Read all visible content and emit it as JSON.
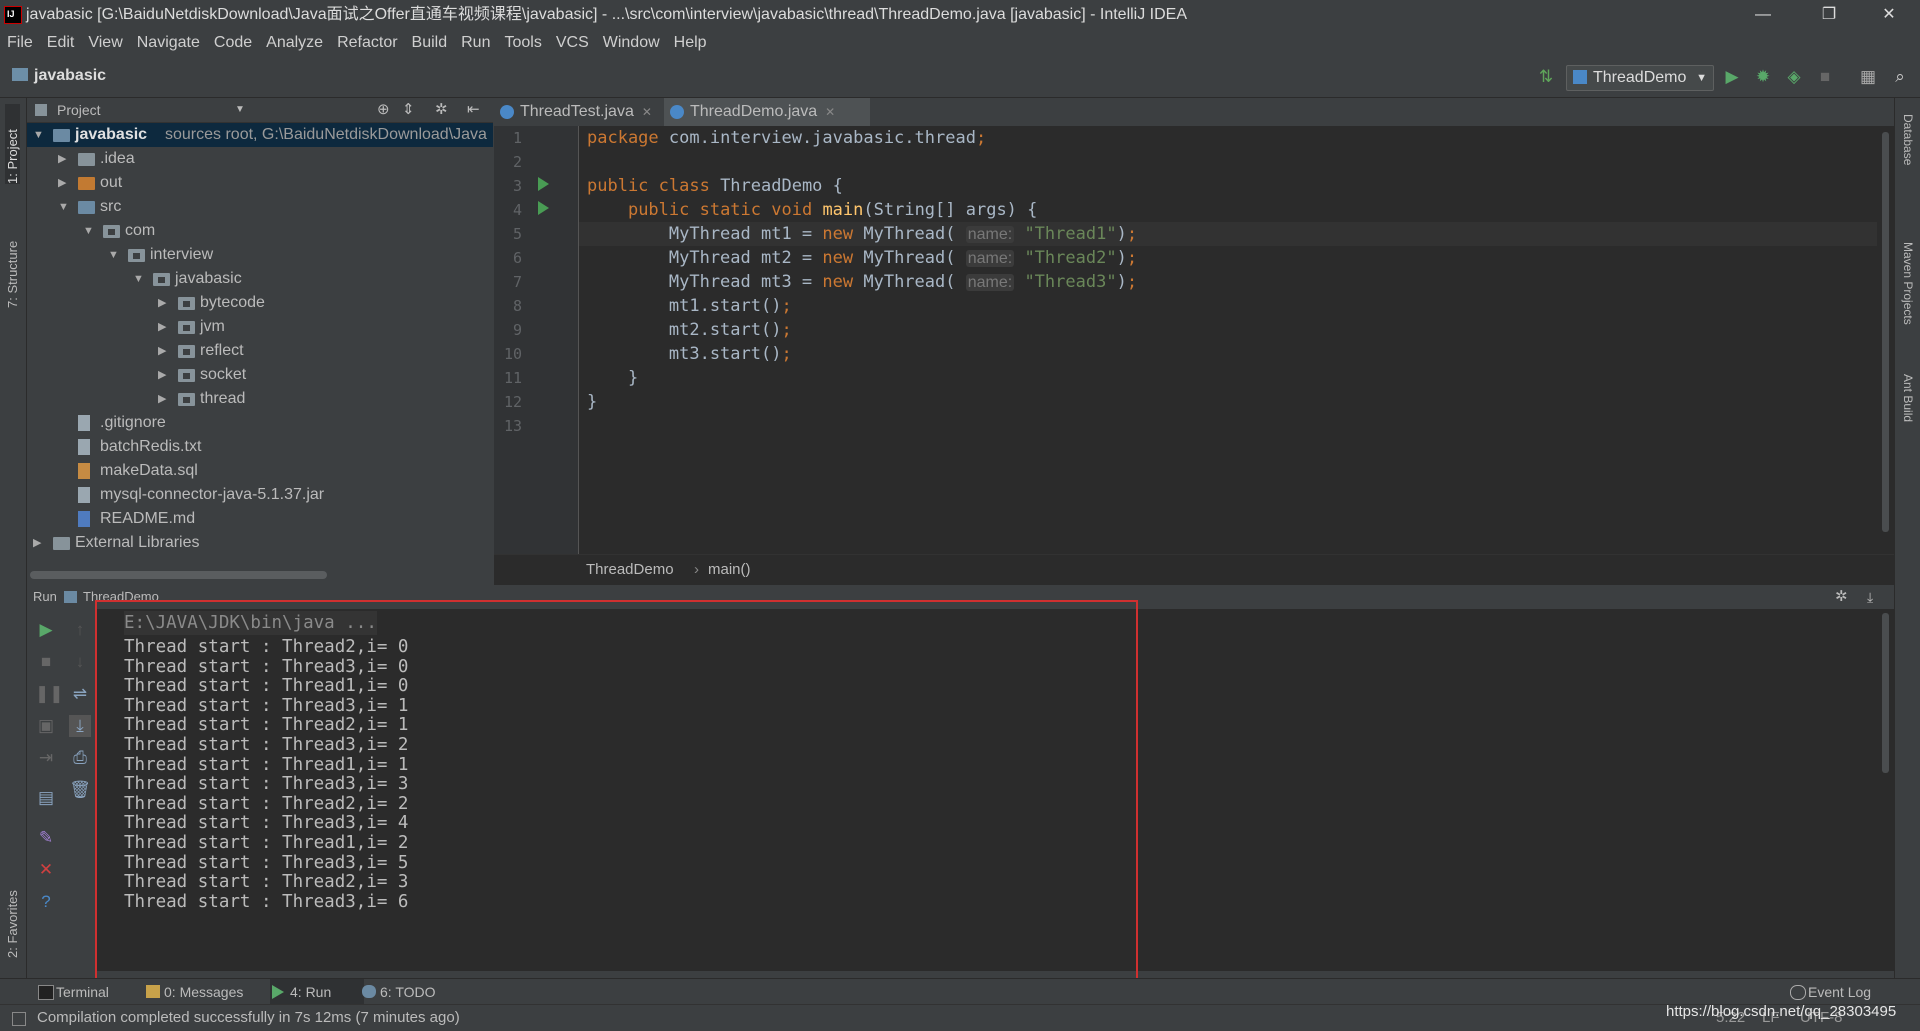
{
  "window": {
    "title": "javabasic [G:\\BaiduNetdiskDownload\\Java面试之Offer直通车视频课程\\javabasic] - ...\\src\\com\\interview\\javabasic\\thread\\ThreadDemo.java [javabasic] - IntelliJ IDEA",
    "minimize": "—",
    "restore": "❐",
    "close": "✕"
  },
  "menu": [
    "File",
    "Edit",
    "View",
    "Navigate",
    "Code",
    "Analyze",
    "Refactor",
    "Build",
    "Run",
    "Tools",
    "VCS",
    "Window",
    "Help"
  ],
  "nav": {
    "project": "javabasic",
    "run_config": "ThreadDemo",
    "icons": [
      "build-icon",
      "run-icon",
      "debug-icon",
      "coverage-icon",
      "stop-icon",
      "project-structure-icon",
      "search-icon"
    ]
  },
  "left_strip": {
    "project": "1: Project",
    "structure": "7: Structure",
    "favorites": "2: Favorites"
  },
  "right_strip": {
    "database": "Database",
    "maven": "Maven Projects",
    "ant": "Ant Build"
  },
  "project_panel": {
    "header": "Project",
    "tree": [
      {
        "label": "javabasic",
        "suffix": "sources root,  G:\\BaiduNetdiskDownload\\Java",
        "depth": 0,
        "expanded": true,
        "type": "module",
        "selected": true
      },
      {
        "label": ".idea",
        "depth": 1,
        "expanded": false,
        "type": "folder"
      },
      {
        "label": "out",
        "depth": 1,
        "expanded": false,
        "type": "folder-orange"
      },
      {
        "label": "src",
        "depth": 1,
        "expanded": true,
        "type": "folder-blue"
      },
      {
        "label": "com",
        "depth": 2,
        "expanded": true,
        "type": "package"
      },
      {
        "label": "interview",
        "depth": 3,
        "expanded": true,
        "type": "package"
      },
      {
        "label": "javabasic",
        "depth": 4,
        "expanded": true,
        "type": "package"
      },
      {
        "label": "bytecode",
        "depth": 5,
        "expanded": false,
        "type": "package"
      },
      {
        "label": "jvm",
        "depth": 5,
        "expanded": false,
        "type": "package"
      },
      {
        "label": "reflect",
        "depth": 5,
        "expanded": false,
        "type": "package"
      },
      {
        "label": "socket",
        "depth": 5,
        "expanded": false,
        "type": "package"
      },
      {
        "label": "thread",
        "depth": 5,
        "expanded": false,
        "type": "package"
      },
      {
        "label": ".gitignore",
        "depth": 1,
        "type": "file"
      },
      {
        "label": "batchRedis.txt",
        "depth": 1,
        "type": "file"
      },
      {
        "label": "makeData.sql",
        "depth": 1,
        "type": "file-sql"
      },
      {
        "label": "mysql-connector-java-5.1.37.jar",
        "depth": 1,
        "type": "file"
      },
      {
        "label": "README.md",
        "depth": 1,
        "type": "file-md"
      },
      {
        "label": "External Libraries",
        "depth": 0,
        "expanded": false,
        "type": "libraries"
      }
    ]
  },
  "editor": {
    "tabs": [
      {
        "label": "ThreadTest.java",
        "active": false
      },
      {
        "label": "ThreadDemo.java",
        "active": true
      }
    ],
    "line_numbers": [
      "1",
      "2",
      "3",
      "4",
      "5",
      "6",
      "7",
      "8",
      "9",
      "10",
      "11",
      "12",
      "13"
    ],
    "hint_name": "name:",
    "breadcrumb": [
      "ThreadDemo",
      "main()"
    ],
    "crumb_sep": "›"
  },
  "run_panel": {
    "label": "Run",
    "config": "ThreadDemo",
    "command": "E:\\JAVA\\JDK\\bin\\java ...",
    "output": [
      "Thread start : Thread2,i= 0",
      "Thread start : Thread3,i= 0",
      "Thread start : Thread1,i= 0",
      "Thread start : Thread3,i= 1",
      "Thread start : Thread2,i= 1",
      "Thread start : Thread3,i= 2",
      "Thread start : Thread1,i= 1",
      "Thread start : Thread3,i= 3",
      "Thread start : Thread2,i= 2",
      "Thread start : Thread3,i= 4",
      "Thread start : Thread1,i= 2",
      "Thread start : Thread3,i= 5",
      "Thread start : Thread2,i= 3",
      "Thread start : Thread3,i= 6"
    ]
  },
  "bottom_tabs": [
    {
      "label": "Terminal",
      "active": false
    },
    {
      "label": "0: Messages",
      "active": false
    },
    {
      "label": "4: Run",
      "active": true
    },
    {
      "label": "6: TODO",
      "active": false
    }
  ],
  "event_log": "Event Log",
  "status": {
    "message": "Compilation completed successfully in 7s 12ms (7 minutes ago)",
    "position": "5:22",
    "line_sep": "LF",
    "encoding": "UTF-8",
    "watermark": "https://blog.csdn.net/qq_28303495"
  },
  "colors": {
    "keyword": "#cc7832",
    "string": "#6a8759",
    "function": "#ffc66d",
    "run_green": "#499c54",
    "highlight_box": "#d03030"
  }
}
